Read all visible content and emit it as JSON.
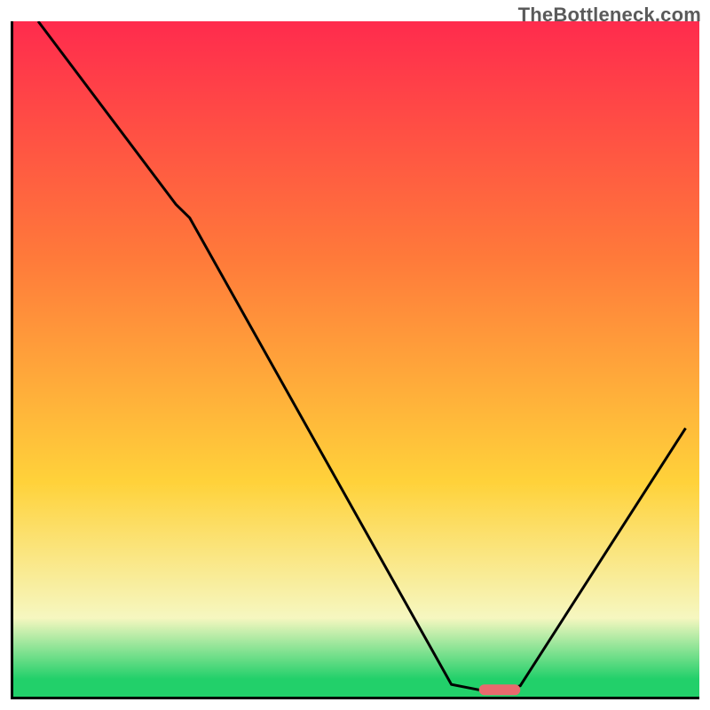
{
  "watermark": "TheBottleneck.com",
  "colors": {
    "top": "#ff2b4d",
    "mid_upper": "#ff7a3a",
    "mid_lower": "#ffd23a",
    "pale": "#f6f7c0",
    "green": "#22d06a",
    "line": "#000000",
    "marker": "#e96a6e",
    "axis": "#000000"
  },
  "chart_data": {
    "type": "line",
    "title": "",
    "xlabel": "",
    "ylabel": "",
    "xlim": [
      0,
      100
    ],
    "ylim": [
      0,
      100
    ],
    "x": [
      4,
      24,
      26,
      64,
      68,
      72,
      74,
      98
    ],
    "y": [
      100,
      73,
      71,
      2.2,
      1.4,
      1.4,
      2.0,
      40
    ],
    "marker": {
      "x_start": 68,
      "x_end": 74,
      "y": 1.4
    },
    "gradient_stops": [
      {
        "offset": 0,
        "color": "#ff2b4d"
      },
      {
        "offset": 35,
        "color": "#ff7a3a"
      },
      {
        "offset": 68,
        "color": "#ffd23a"
      },
      {
        "offset": 88,
        "color": "#f6f7c0"
      },
      {
        "offset": 97,
        "color": "#22d06a"
      }
    ]
  }
}
